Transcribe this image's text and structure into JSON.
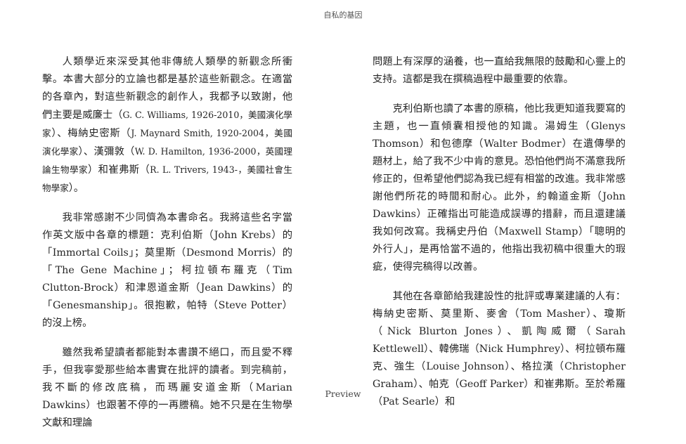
{
  "header": {
    "title": "自私的基因"
  },
  "left_column": {
    "p1": {
      "a": "人類學近來深受其他非傳統人類學的新觀念所衝擊。本書大部分的立論也都是基於這些新觀念。在適當的各章內，對這些新觀念的創作人，我都予以致謝，他們主要是威廉士（",
      "n1": "G. C. Williams, 1926-2010，美國演化學家",
      "b": "）、梅納史密斯（",
      "n2": "J. Maynard Smith, 1920-2004，美國演化學家",
      "c": "）、漢彌敦（",
      "n3": "W. D. Hamilton, 1936-2000，英國理論生物學家",
      "d": "）和崔弗斯（",
      "n4": "R. L. Trivers, 1943-，美國社會生物學家",
      "e": "）。"
    },
    "p2": "我非常感謝不少同儕為本書命名。我將這些名字當作英文版中各章的標題：克利伯斯（John Krebs）的「Immortal Coils」；莫里斯（Desmond Morris）的「The Gene Machine」；柯拉頓布羅克（Tim Clutton-Brock）和津恩道金斯（Jean Dawkins）的「Genesmanship」。很抱歉，帕特（Steve Potter）的沒上榜。",
    "p3": "雖然我希望讀者都能對本書讚不絕口，而且愛不釋手，但我寧愛那些給本書實在批評的讀者。到完稿前，我不斷的修改底稿，而瑪麗安道金斯（Marian Dawkins）也跟著不停的一再謄稿。她不只是在生物學文獻和理論"
  },
  "right_column": {
    "p1": "問題上有深厚的涵養，也一直給我無限的鼓勵和心靈上的支持。這都是我在撰稿過程中最重要的依靠。",
    "p2": "克利伯斯也讀了本書的原稿，他比我更知道我要寫的主題，也一直傾囊相授他的知識。湯姆生（Glenys Thomson）和包德摩（Walter Bodmer）在遺傳學的題材上，給了我不少中肯的意見。恐怕他們尚不滿意我所修正的，但希望他們認為我已經有相當的改進。我非常感謝他們所花的時間和耐心。此外，約翰道金斯（John Dawkins）正確指出可能造成誤導的措辭，而且還建議我如何改寫。我稱史丹伯（Maxwell Stamp）「聰明的外行人」，是再恰當不過的，他指出我初稿中很重大的瑕疵，使得完稿得以改善。",
    "p3": "其他在各章節給我建設性的批評或專業建議的人有：梅納史密斯、莫里斯、麥舍（Tom Masher）、瓊斯（Nick Blurton Jones）、凱陶威爾（Sarah Kettlewell）、韓佛瑞（Nick Humphrey）、柯拉頓布羅克、強生（Louise Johnson）、格拉漢（Christopher Graham）、帕克（Geoff Parker）和崔弗斯。至於希羅（Pat Searle）和"
  },
  "footer": {
    "label": "Preview"
  }
}
